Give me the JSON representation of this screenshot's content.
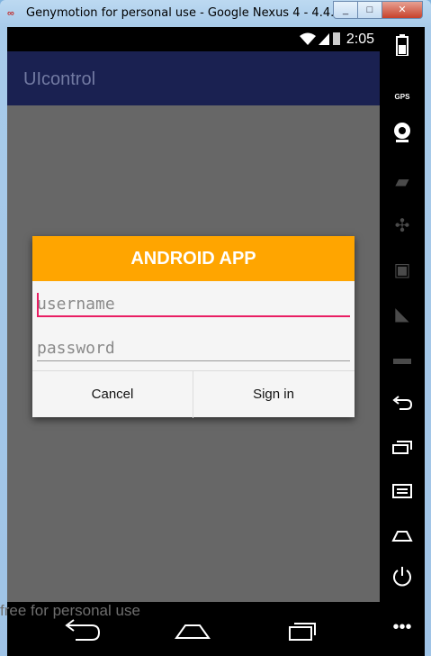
{
  "window": {
    "title": "Genymotion for personal use - Google Nexus 4 - 4.4.4 - ...",
    "min": "_",
    "max": "□",
    "close": "✕"
  },
  "statusbar": {
    "time": "2:05"
  },
  "app": {
    "title": "UIcontrol"
  },
  "dialog": {
    "title": "ANDROID APP",
    "username_placeholder": "username",
    "password_placeholder": "password",
    "cancel": "Cancel",
    "signin": "Sign in"
  },
  "sidebar": {
    "gps_label": "GPS"
  },
  "watermark": "free for personal use"
}
